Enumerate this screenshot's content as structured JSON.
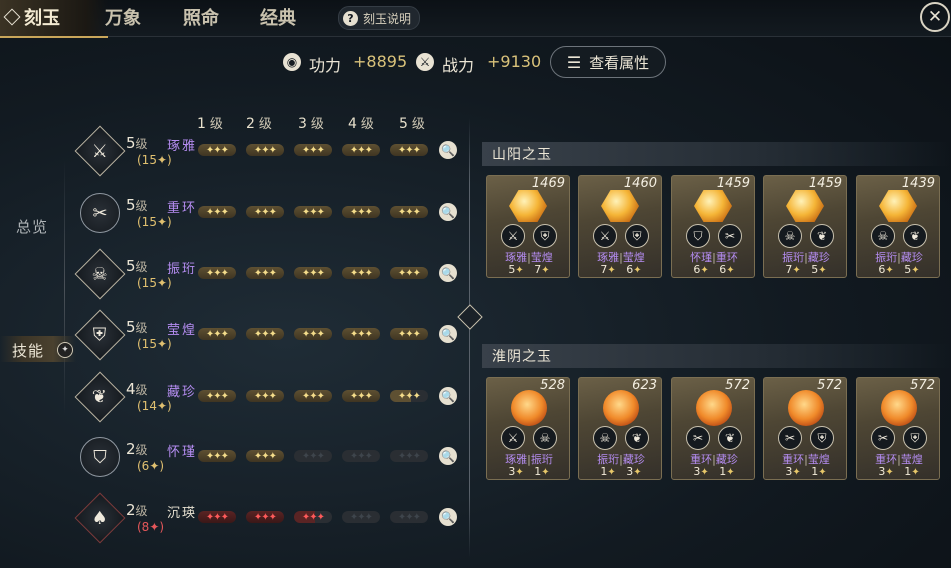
{
  "tabs": [
    "刻玉",
    "万象",
    "照命",
    "经典"
  ],
  "help_label": "刻玉说明",
  "close_icon": "✕",
  "stats": {
    "gongli_label": "功力",
    "gongli_value": "+8895",
    "zhanli_label": "战力",
    "zhanli_value": "+9130",
    "attr_button": "查看属性"
  },
  "nav": {
    "overview": "总览",
    "skills": "技能"
  },
  "level_headers": [
    {
      "num": "1",
      "unit": "级"
    },
    {
      "num": "2",
      "unit": "级"
    },
    {
      "num": "3",
      "unit": "级"
    },
    {
      "num": "4",
      "unit": "级"
    },
    {
      "num": "5",
      "unit": "级"
    }
  ],
  "skills": [
    {
      "level": "5",
      "unit": "级",
      "name": "琢雅",
      "sub": "(15✦)",
      "icon": "sword-cross-icon",
      "glyph": "⚔",
      "pips": [
        "g",
        "g",
        "g",
        "g",
        "g"
      ]
    },
    {
      "level": "5",
      "unit": "级",
      "name": "重环",
      "sub": "(15✦)",
      "icon": "slash-icon",
      "glyph": "✂",
      "pips": [
        "g",
        "g",
        "g",
        "g",
        "g"
      ]
    },
    {
      "level": "5",
      "unit": "级",
      "name": "振珩",
      "sub": "(15✦)",
      "icon": "demon-mask-icon",
      "glyph": "☠",
      "pips": [
        "g",
        "g",
        "g",
        "g",
        "g"
      ]
    },
    {
      "level": "5",
      "unit": "级",
      "name": "莹煌",
      "sub": "(15✦)",
      "icon": "shield-icon",
      "glyph": "⛨",
      "pips": [
        "g",
        "g",
        "g",
        "g",
        "g"
      ]
    },
    {
      "level": "4",
      "unit": "级",
      "name": "藏珍",
      "sub": "(14✦)",
      "icon": "phoenix-icon",
      "glyph": "❦",
      "pips": [
        "g",
        "g",
        "g",
        "g",
        "p"
      ]
    },
    {
      "level": "2",
      "unit": "级",
      "name": "怀瑾",
      "sub": "(6✦)",
      "icon": "shield-round-icon",
      "glyph": "⛉",
      "pips": [
        "g",
        "g",
        "e",
        "e",
        "e"
      ]
    },
    {
      "level": "2",
      "unit": "级",
      "name": "沉瑛",
      "sub": "(8✦)",
      "icon": "drop-icon",
      "glyph": "♠",
      "pips": [
        "r",
        "r",
        "pr",
        "e",
        "e"
      ]
    }
  ],
  "groups": [
    {
      "title": "山阳之玉",
      "cards": [
        {
          "num": "1469",
          "gem": "hex",
          "icons": [
            "⚔",
            "⛨"
          ],
          "names": [
            "琢雅",
            "莹煌"
          ],
          "vals": [
            "5",
            "7"
          ]
        },
        {
          "num": "1460",
          "gem": "hex",
          "icons": [
            "⚔",
            "⛨"
          ],
          "names": [
            "琢雅",
            "莹煌"
          ],
          "vals": [
            "7",
            "6"
          ]
        },
        {
          "num": "1459",
          "gem": "hex",
          "icons": [
            "⛉",
            "✂"
          ],
          "names": [
            "怀瑾",
            "重环"
          ],
          "vals": [
            "6",
            "6"
          ]
        },
        {
          "num": "1459",
          "gem": "hex",
          "icons": [
            "☠",
            "❦"
          ],
          "names": [
            "振珩",
            "藏珍"
          ],
          "vals": [
            "7",
            "5"
          ]
        },
        {
          "num": "1439",
          "gem": "hex",
          "icons": [
            "☠",
            "❦"
          ],
          "names": [
            "振珩",
            "藏珍"
          ],
          "vals": [
            "6",
            "5"
          ]
        }
      ]
    },
    {
      "title": "淮阴之玉",
      "cards": [
        {
          "num": "528",
          "gem": "ball",
          "icons": [
            "⚔",
            "☠"
          ],
          "names": [
            "琢雅",
            "振珩"
          ],
          "vals": [
            "3",
            "1"
          ]
        },
        {
          "num": "623",
          "gem": "ball",
          "icons": [
            "☠",
            "❦"
          ],
          "names": [
            "振珩",
            "藏珍"
          ],
          "vals": [
            "1",
            "3"
          ]
        },
        {
          "num": "572",
          "gem": "ball",
          "icons": [
            "✂",
            "❦"
          ],
          "names": [
            "重环",
            "藏珍"
          ],
          "vals": [
            "3",
            "1"
          ]
        },
        {
          "num": "572",
          "gem": "ball",
          "icons": [
            "✂",
            "⛨"
          ],
          "names": [
            "重环",
            "莹煌"
          ],
          "vals": [
            "3",
            "1"
          ]
        },
        {
          "num": "572",
          "gem": "ball",
          "icons": [
            "✂",
            "⛨"
          ],
          "names": [
            "重环",
            "莹煌"
          ],
          "vals": [
            "3",
            "1"
          ]
        }
      ]
    }
  ]
}
